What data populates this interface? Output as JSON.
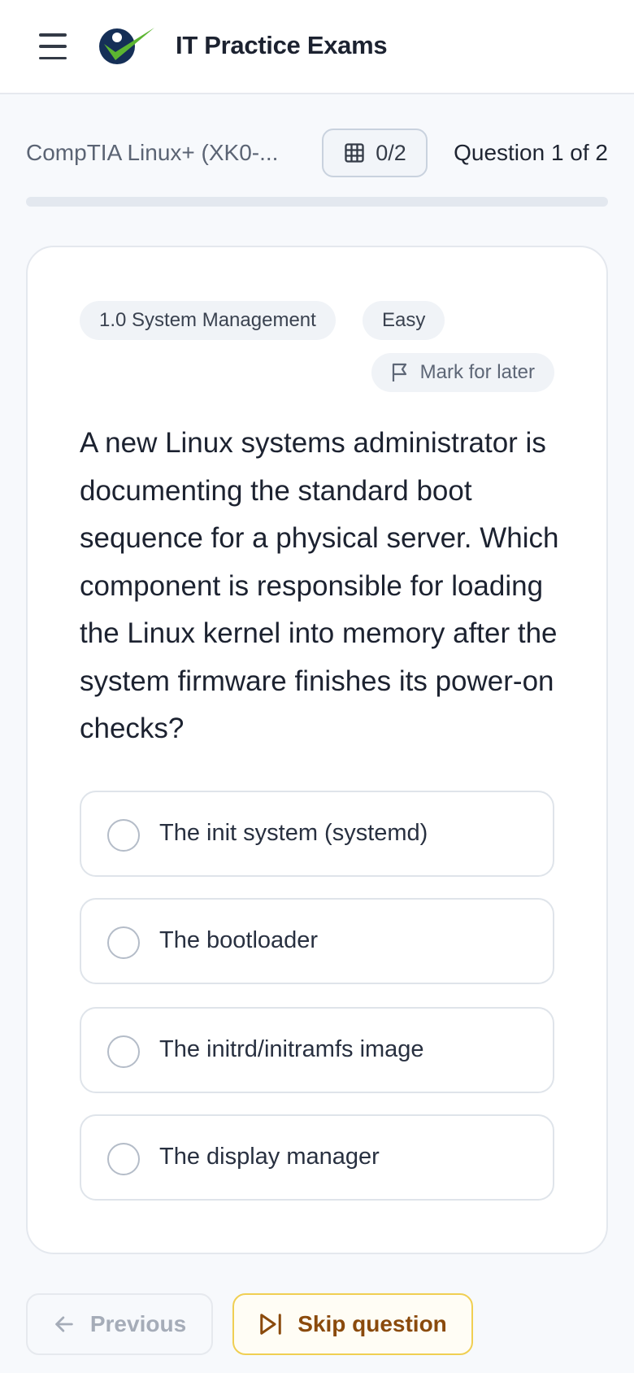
{
  "header": {
    "brand": "IT Practice Exams",
    "icons": {
      "menu": "hamburger-menu-icon",
      "logo": "checkmark-person-logo"
    }
  },
  "exam": {
    "name": "CompTIA Linux+ (XK0-...",
    "answered_label": "0/2",
    "answered_fraction": 0,
    "question_position": "Question 1 of 2",
    "grid_icon": "grid-icon"
  },
  "question": {
    "domain_tag": "1.0 System Management",
    "difficulty": "Easy",
    "mark_label": "Mark for later",
    "mark_icon": "flag-icon",
    "text": "A new Linux systems administrator is documenting the standard boot sequence for a physical server. Which component is responsible for loading the Linux kernel into memory after the system firmware finishes its power-on checks?",
    "options": [
      {
        "label": "The init system (systemd)"
      },
      {
        "label": "The bootloader"
      },
      {
        "label": "The initrd/initramfs image"
      },
      {
        "label": "The display manager"
      }
    ]
  },
  "nav": {
    "previous_label": "Previous",
    "skip_label": "Skip question",
    "previous_icon": "arrow-left-icon",
    "skip_icon": "skip-forward-icon"
  },
  "colors": {
    "accent_border": "#f0cf53",
    "skip_text": "#8a4a0c",
    "logo_green": "#5cb531",
    "logo_navy": "#152f57"
  }
}
